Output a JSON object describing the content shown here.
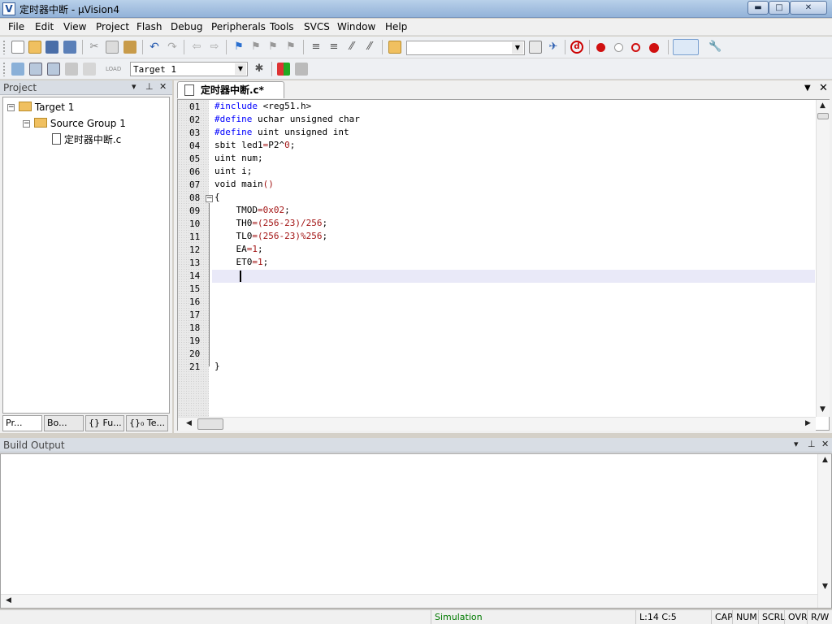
{
  "window": {
    "title": "定时器中断 - μVision4",
    "minimize_glyph": "▬",
    "maximize_glyph": "□",
    "close_glyph": "✕"
  },
  "menu": [
    {
      "label": "File",
      "accel": "F"
    },
    {
      "label": "Edit",
      "accel": "E"
    },
    {
      "label": "View",
      "accel": "V"
    },
    {
      "label": "Project",
      "accel": "P"
    },
    {
      "label": "Flash",
      "accel": "a"
    },
    {
      "label": "Debug",
      "accel": "D"
    },
    {
      "label": "Peripherals",
      "accel": "k"
    },
    {
      "label": "Tools",
      "accel": "T"
    },
    {
      "label": "SVCS",
      "accel": "S"
    },
    {
      "label": "Window",
      "accel": "W"
    },
    {
      "label": "Help",
      "accel": "H"
    }
  ],
  "toolbar": {
    "find_combo_value": "",
    "target_combo_value": "Target 1"
  },
  "project_panel": {
    "title": "Project",
    "tree": {
      "target": "Target 1",
      "group": "Source Group 1",
      "file": "定时器中断.c"
    },
    "tabs": [
      "Pr...",
      "Bo...",
      "{} Fu...",
      "{}₀ Te..."
    ]
  },
  "editor": {
    "tab_label": "定时器中断.c*",
    "line_numbers": [
      "01",
      "02",
      "03",
      "04",
      "05",
      "06",
      "07",
      "08",
      "09",
      "10",
      "11",
      "12",
      "13",
      "14",
      "15",
      "16",
      "17",
      "18",
      "19",
      "20",
      "21"
    ],
    "code": [
      {
        "kw": "#include",
        "rest": " <reg51.h>"
      },
      {
        "kw": "#define",
        "rest": " uchar unsigned char"
      },
      {
        "kw": "#define",
        "rest": " uint unsigned int"
      },
      {
        "kw": "",
        "rest": "sbit led1=P2^0;"
      },
      {
        "kw": "",
        "rest": "uint num;"
      },
      {
        "kw": "",
        "rest": "uint i;"
      },
      {
        "kw": "",
        "rest": "void main()"
      },
      {
        "kw": "",
        "rest": "{"
      },
      {
        "kw": "",
        "rest": "    TMOD=0x02;"
      },
      {
        "kw": "",
        "rest": "    TH0=(256-23)/256;"
      },
      {
        "kw": "",
        "rest": "    TL0=(256-23)%256;"
      },
      {
        "kw": "",
        "rest": "    EA=1;"
      },
      {
        "kw": "",
        "rest": "    ET0=1;"
      },
      {
        "kw": "",
        "rest": ""
      },
      {
        "kw": "",
        "rest": ""
      },
      {
        "kw": "",
        "rest": ""
      },
      {
        "kw": "",
        "rest": ""
      },
      {
        "kw": "",
        "rest": ""
      },
      {
        "kw": "",
        "rest": ""
      },
      {
        "kw": "",
        "rest": ""
      },
      {
        "kw": "",
        "rest": "}"
      }
    ]
  },
  "build_output": {
    "title": "Build Output"
  },
  "status_bar": {
    "mode": "Simulation",
    "position": "L:14 C:5",
    "cap": "CAP",
    "num": "NUM",
    "scrl": "SCRL",
    "ovr": "OVR",
    "rw": "R/W"
  },
  "colors": {
    "keyword": "#0000ff",
    "number": "#a31515",
    "current_line": "#e9e9f8",
    "status_mode": "#007a00"
  }
}
